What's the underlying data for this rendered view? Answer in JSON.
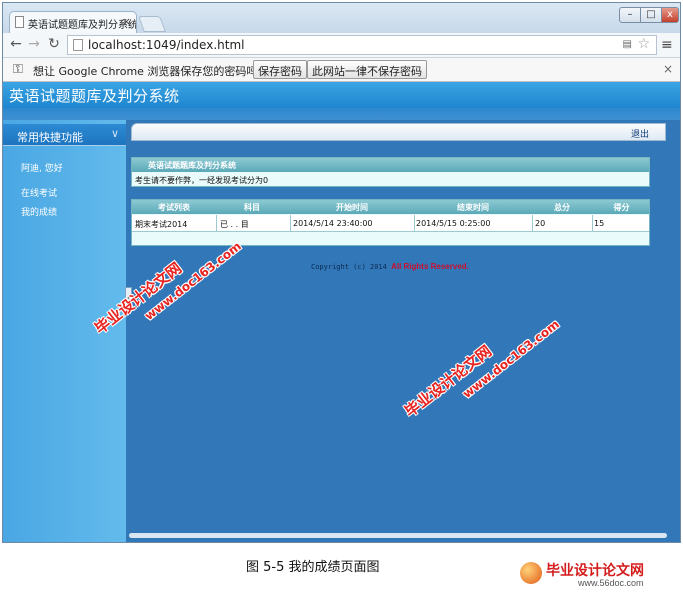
{
  "browser": {
    "tab_title": "英语试题题库及判分系统",
    "tab_close": "×",
    "url": "localhost:1049/index.html",
    "window_controls": {
      "minimize": "–",
      "maximize": "□",
      "close": "x"
    },
    "password_bar": {
      "message": "想让 Google Chrome 浏览器保存您的密码吗？",
      "save_button": "保存密码",
      "never_button": "此网站一律不保存密码",
      "close": "×"
    }
  },
  "app": {
    "title": "英语试题题库及判分系统",
    "sidebar": {
      "section_title": "常用快捷功能",
      "items": [
        "阿迪, 您好",
        "在线考试",
        "我的成绩"
      ]
    },
    "topbar": {
      "logout": "退出"
    },
    "info_panel": {
      "title": "英语试题题库及判分系统",
      "notice": "考生请不要作弊，一经发现考试分为0"
    },
    "results_table": {
      "columns": [
        "考试列表",
        "科目",
        "开始时间",
        "结束时间",
        "总分",
        "得分"
      ],
      "rows": [
        [
          "期末考试2014",
          "已 . . 目",
          "2014/5/14 23:40:00",
          "2014/5/15 0:25:00",
          "20",
          "15"
        ]
      ]
    },
    "copyright_prefix": "Copyright (c) 2014",
    "copyright_suffix": "All Rights Reserved."
  },
  "watermarks": [
    "毕业设计论文网",
    "www.doc163.com"
  ],
  "caption": "图 5-5 我的成绩页面图",
  "footer_logo": {
    "name": "毕业设计论文网",
    "site": "www.56doc.com"
  }
}
